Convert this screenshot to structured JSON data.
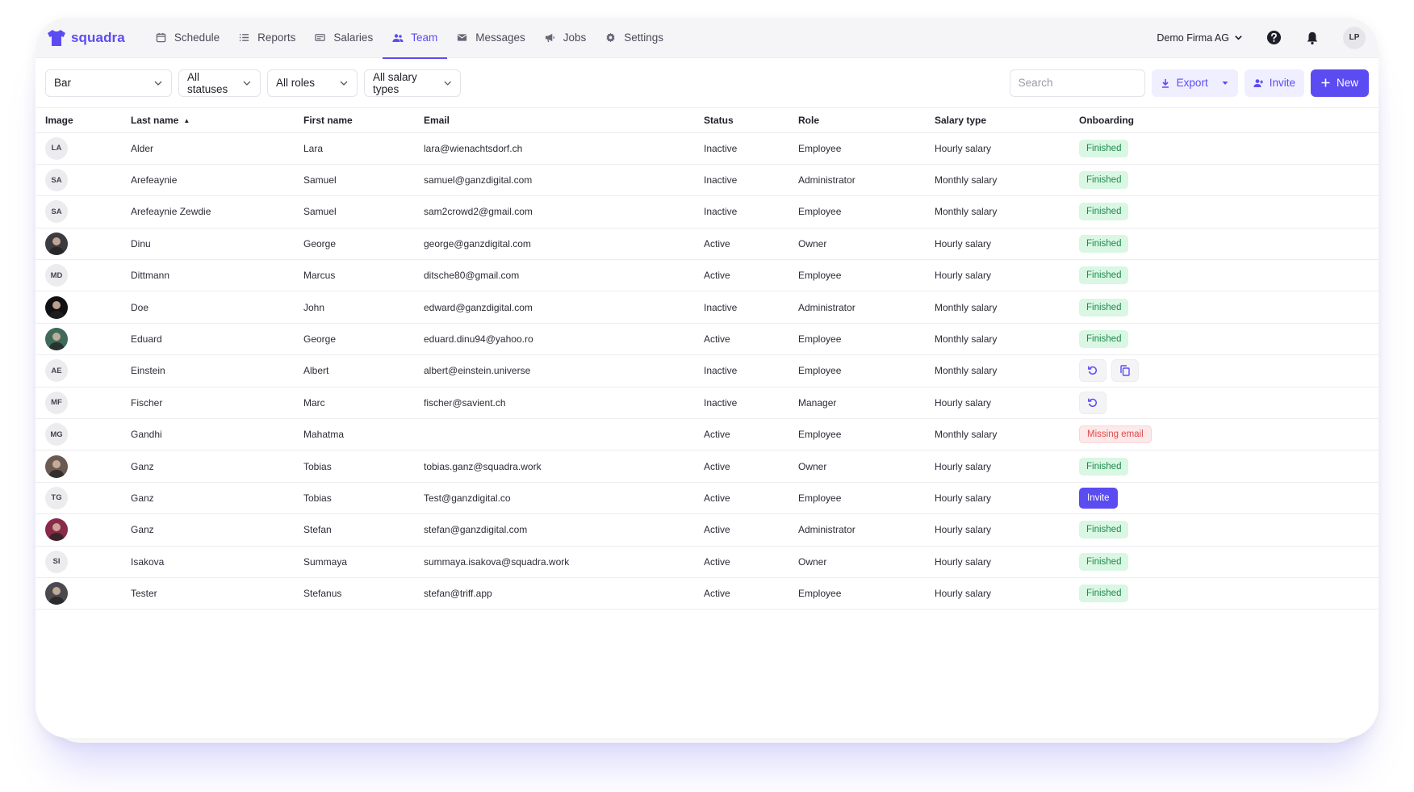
{
  "brand": {
    "name": "squadra",
    "accent": "#5b4cf2"
  },
  "nav": [
    {
      "label": "Schedule",
      "icon": "calendar-icon"
    },
    {
      "label": "Reports",
      "icon": "list-icon"
    },
    {
      "label": "Salaries",
      "icon": "money-icon"
    },
    {
      "label": "Team",
      "icon": "team-icon",
      "active": true
    },
    {
      "label": "Messages",
      "icon": "mail-icon"
    },
    {
      "label": "Jobs",
      "icon": "megaphone-icon"
    },
    {
      "label": "Settings",
      "icon": "gear-icon"
    }
  ],
  "header": {
    "company": "Demo Firma AG",
    "user_initials": "LP"
  },
  "filters": {
    "location": "Bar",
    "status": "All statuses",
    "role": "All roles",
    "salary_type": "All salary types"
  },
  "search": {
    "placeholder": "Search"
  },
  "actions": {
    "export": "Export",
    "invite": "Invite",
    "new": "New"
  },
  "table": {
    "columns": [
      "Image",
      "Last name",
      "First name",
      "Email",
      "Status",
      "Role",
      "Salary type",
      "Onboarding"
    ],
    "rows": [
      {
        "initials": "LA",
        "photo": null,
        "last": "Alder",
        "first": "Lara",
        "email": "lara@wienachtsdorf.ch",
        "status": "Inactive",
        "role": "Employee",
        "salary": "Hourly salary",
        "onboarding": {
          "type": "finished",
          "label": "Finished"
        }
      },
      {
        "initials": "SA",
        "photo": null,
        "last": "Arefeaynie",
        "first": "Samuel",
        "email": "samuel@ganzdigital.com",
        "status": "Inactive",
        "role": "Administrator",
        "salary": "Monthly salary",
        "onboarding": {
          "type": "finished",
          "label": "Finished"
        }
      },
      {
        "initials": "SA",
        "photo": null,
        "last": "Arefeaynie Zewdie",
        "first": "Samuel",
        "email": "sam2crowd2@gmail.com",
        "status": "Inactive",
        "role": "Employee",
        "salary": "Monthly salary",
        "onboarding": {
          "type": "finished",
          "label": "Finished"
        }
      },
      {
        "initials": "",
        "photo": "#3b3b40",
        "last": "Dinu",
        "first": "George",
        "email": "george@ganzdigital.com",
        "status": "Active",
        "role": "Owner",
        "salary": "Hourly salary",
        "onboarding": {
          "type": "finished",
          "label": "Finished"
        }
      },
      {
        "initials": "MD",
        "photo": null,
        "last": "Dittmann",
        "first": "Marcus",
        "email": "ditsche80@gmail.com",
        "status": "Active",
        "role": "Employee",
        "salary": "Hourly salary",
        "onboarding": {
          "type": "finished",
          "label": "Finished"
        }
      },
      {
        "initials": "",
        "photo": "#111114",
        "last": "Doe",
        "first": "John",
        "email": "edward@ganzdigital.com",
        "status": "Inactive",
        "role": "Administrator",
        "salary": "Monthly salary",
        "onboarding": {
          "type": "finished",
          "label": "Finished"
        }
      },
      {
        "initials": "",
        "photo": "#3f6a5a",
        "last": "Eduard",
        "first": "George",
        "email": "eduard.dinu94@yahoo.ro",
        "status": "Active",
        "role": "Employee",
        "salary": "Monthly salary",
        "onboarding": {
          "type": "finished",
          "label": "Finished"
        }
      },
      {
        "initials": "AE",
        "photo": null,
        "last": "Einstein",
        "first": "Albert",
        "email": "albert@einstein.universe",
        "status": "Inactive",
        "role": "Employee",
        "salary": "Monthly salary",
        "onboarding": {
          "type": "actions",
          "buttons": [
            "refresh-icon",
            "copy-icon"
          ]
        }
      },
      {
        "initials": "MF",
        "photo": null,
        "last": "Fischer",
        "first": "Marc",
        "email": "fischer@savient.ch",
        "status": "Inactive",
        "role": "Manager",
        "salary": "Hourly salary",
        "onboarding": {
          "type": "actions",
          "buttons": [
            "refresh-icon"
          ]
        }
      },
      {
        "initials": "MG",
        "photo": null,
        "last": "Gandhi",
        "first": "Mahatma",
        "email": "",
        "status": "Active",
        "role": "Employee",
        "salary": "Monthly salary",
        "onboarding": {
          "type": "missing",
          "label": "Missing email"
        }
      },
      {
        "initials": "",
        "photo": "#6b5a52",
        "last": "Ganz",
        "first": "Tobias",
        "email": "tobias.ganz@squadra.work",
        "status": "Active",
        "role": "Owner",
        "salary": "Hourly salary",
        "onboarding": {
          "type": "finished",
          "label": "Finished"
        }
      },
      {
        "initials": "TG",
        "photo": null,
        "last": "Ganz",
        "first": "Tobias",
        "email": "Test@ganzdigital.co",
        "status": "Active",
        "role": "Employee",
        "salary": "Hourly salary",
        "onboarding": {
          "type": "invite",
          "label": "Invite"
        }
      },
      {
        "initials": "",
        "photo": "#8a2a4a",
        "last": "Ganz",
        "first": "Stefan",
        "email": "stefan@ganzdigital.com",
        "status": "Active",
        "role": "Administrator",
        "salary": "Hourly salary",
        "onboarding": {
          "type": "finished",
          "label": "Finished"
        }
      },
      {
        "initials": "SI",
        "photo": null,
        "last": "Isakova",
        "first": "Summaya",
        "email": "summaya.isakova@squadra.work",
        "status": "Active",
        "role": "Owner",
        "salary": "Hourly salary",
        "onboarding": {
          "type": "finished",
          "label": "Finished"
        }
      },
      {
        "initials": "",
        "photo": "#4a4a4f",
        "last": "Tester",
        "first": "Stefanus",
        "email": "stefan@triff.app",
        "status": "Active",
        "role": "Employee",
        "salary": "Hourly salary",
        "onboarding": {
          "type": "finished",
          "label": "Finished"
        }
      }
    ]
  }
}
